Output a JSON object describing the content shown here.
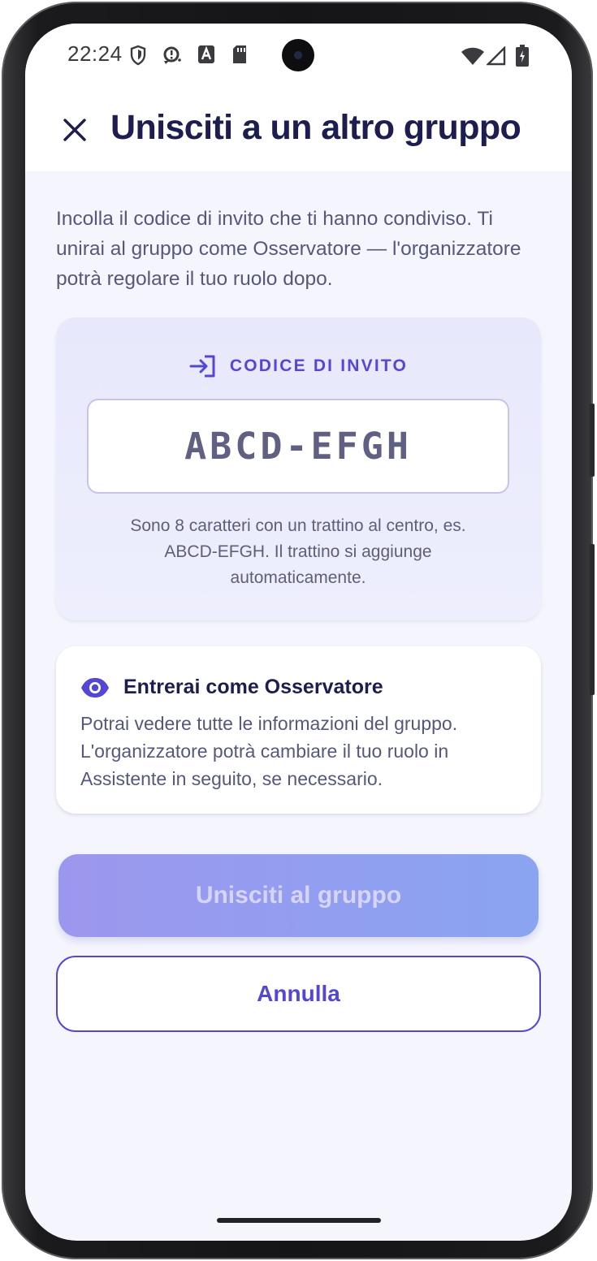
{
  "status_bar": {
    "time": "22:24",
    "left_icons": [
      "shield-icon",
      "sync-alert-icon",
      "font-a-icon",
      "sd-card-icon"
    ],
    "right_icons": [
      "wifi-icon",
      "cell-signal-icon",
      "battery-charging-icon"
    ]
  },
  "header": {
    "close_icon": "close-icon",
    "title": "Unisciti a un altro gruppo"
  },
  "intro": {
    "text": "Incolla il codice di invito che ti hanno condiviso. Ti unirai al gruppo come Osservatore — l'organizzatore potrà regolare il tuo ruolo dopo."
  },
  "invite_card": {
    "icon": "login-icon",
    "label": "CODICE DI INVITO",
    "input_value": "",
    "input_placeholder": "ABCD-EFGH",
    "help_text": "Sono 8 caratteri con un trattino al centro, es. ABCD-EFGH. Il trattino si aggiunge automaticamente."
  },
  "observer_card": {
    "icon": "eye-icon",
    "title": "Entrerai come Osservatore",
    "description": "Potrai vedere tutte le informazioni del gruppo. L'organizzatore potrà cambiare il tuo ruolo in Assistente in seguito, se necessario."
  },
  "actions": {
    "join_label": "Unisciti al gruppo",
    "join_enabled": false,
    "cancel_label": "Annulla"
  },
  "colors": {
    "accent": "#5447d4",
    "title": "#1d1d4f",
    "body_text": "#55587a",
    "background": "#f5f6fd",
    "card_tint": "#e9eafc",
    "join_gradient_start": "#9c97ee",
    "join_gradient_end": "#8aa4f1"
  }
}
